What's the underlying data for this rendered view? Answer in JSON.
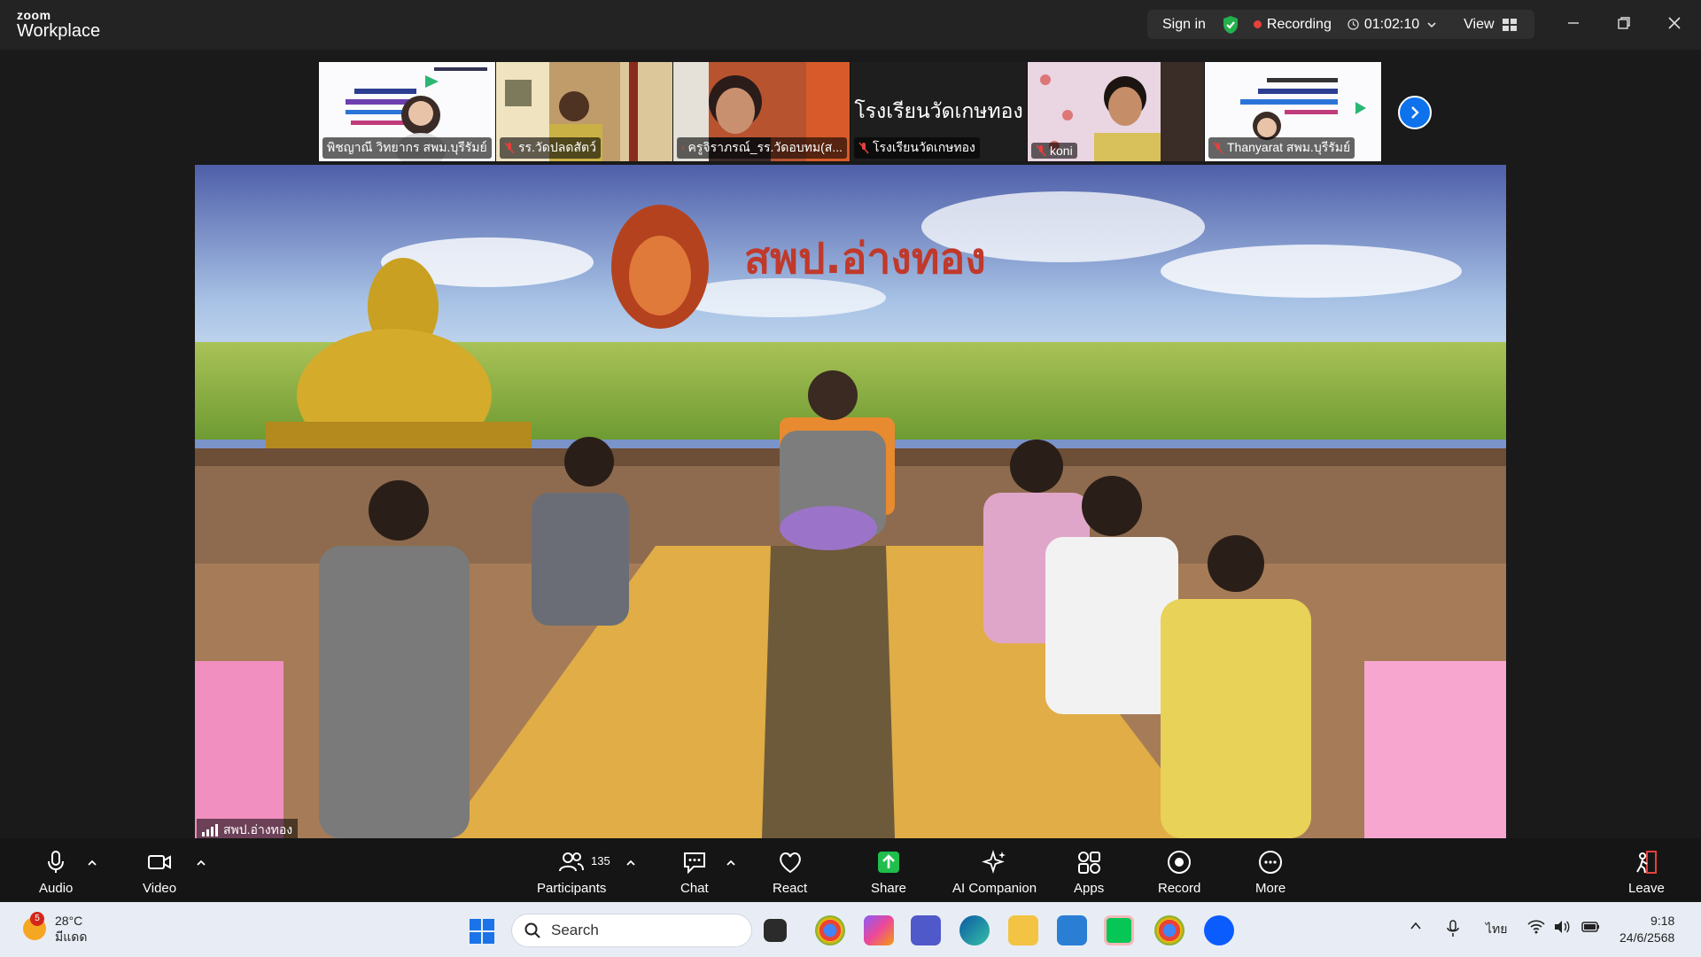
{
  "app": {
    "brand_top": "zoom",
    "brand_bottom": "Workplace"
  },
  "titlebar": {
    "sign_in": "Sign in",
    "recording": "Recording",
    "timer": "01:02:10",
    "view": "View"
  },
  "thumbnails": [
    {
      "name": "พิชญาณี วิทยากร สพม.บุรีรัมย์",
      "muted": false
    },
    {
      "name": "รร.วัดปลดสัตว์",
      "muted": true
    },
    {
      "name": "ครูจิราภรณ์_รร.วัดอบทม(ส...",
      "muted": true
    },
    {
      "name": "โรงเรียนวัดเกษทอง",
      "muted": true,
      "big_text": "โรงเรียนวัดเกษทอง"
    },
    {
      "name": "koni",
      "muted": true
    },
    {
      "name": "Thanyarat สพม.บุรีรัมย์",
      "muted": true
    }
  ],
  "main_video": {
    "label": "สพป.อ่างทอง",
    "banner_text": "สพป.อ่างทอง"
  },
  "toolbar": {
    "audio": "Audio",
    "video": "Video",
    "participants": "Participants",
    "participants_count": "135",
    "chat": "Chat",
    "react": "React",
    "share": "Share",
    "ai_companion": "AI Companion",
    "apps": "Apps",
    "record": "Record",
    "more": "More",
    "leave": "Leave"
  },
  "taskbar": {
    "weather_temp": "28°C",
    "weather_desc": "มีแดด",
    "weather_badge": "5",
    "search_placeholder": "Search",
    "language": "ไทย",
    "time": "9:18",
    "date": "24/6/2568"
  },
  "colors": {
    "accent": "#0e72ed",
    "share": "#1fbe4d",
    "recording": "#e5413b",
    "leave": "#e5413b"
  }
}
